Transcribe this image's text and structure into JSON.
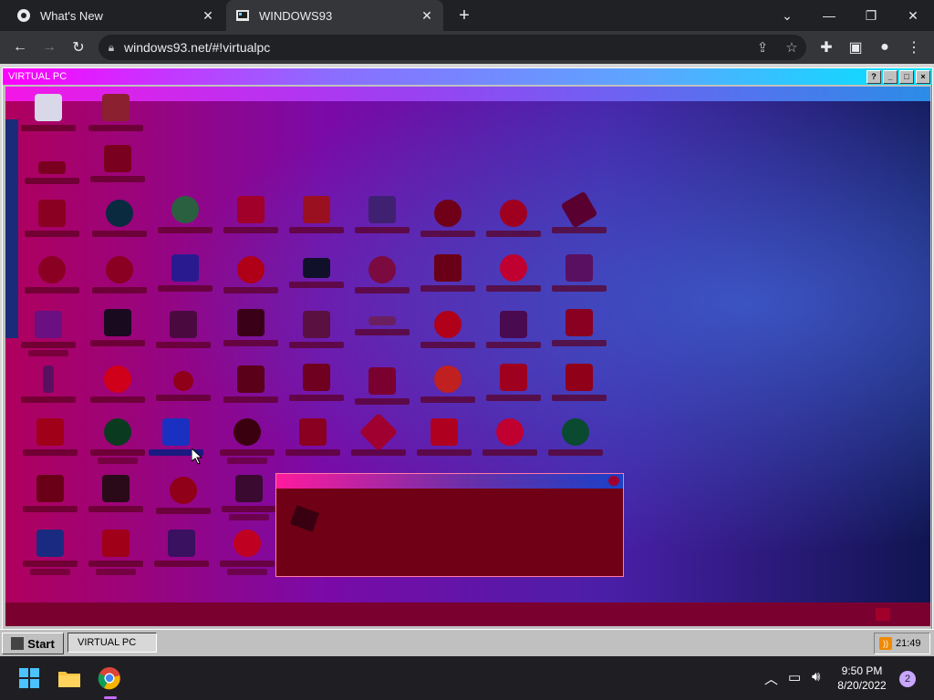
{
  "browser": {
    "tabs": [
      {
        "title": "What's New",
        "icon": "chrome-icon"
      },
      {
        "title": "WINDOWS93",
        "icon": "windows93-icon"
      }
    ],
    "new_tab": "+",
    "url": "windows93.net/#!virtualpc"
  },
  "vpc": {
    "title": "VIRTUAL PC",
    "buttons": [
      "?",
      "_",
      "□",
      "×"
    ]
  },
  "w93taskbar": {
    "start_label": "Start",
    "task_label": "VIRTUAL PC",
    "time": "21:49"
  },
  "ostaskbar": {
    "time": "9:50 PM",
    "date": "8/20/2022",
    "notifications": "2"
  },
  "colors": {
    "chrome_dark": "#202124",
    "chrome_toolbar": "#35363a",
    "w93_gray": "#c0c0c0"
  }
}
